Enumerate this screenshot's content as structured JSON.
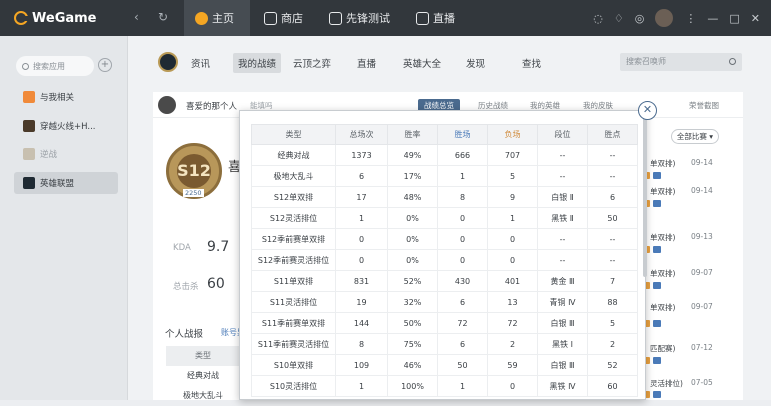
{
  "app": {
    "brand": "WeGame",
    "nav": [
      {
        "label": "主页",
        "active": true
      },
      {
        "label": "商店",
        "active": false
      },
      {
        "label": "先锋测试",
        "active": false
      },
      {
        "label": "直播",
        "active": false
      }
    ],
    "icons": [
      "back-arrow-icon",
      "refresh-icon",
      "chat-icon",
      "gift-icon",
      "game-controller-icon",
      "menu-icon",
      "minimize-icon",
      "maximize-icon",
      "close-icon"
    ]
  },
  "sidebar": {
    "search_placeholder": "搜索应用",
    "items": [
      {
        "label": "与我相关",
        "color": "#f08a3a"
      },
      {
        "label": "穿越火线+H...",
        "color": "#4a3a2a"
      },
      {
        "label": "逆战",
        "color": "#c8c0b0"
      },
      {
        "label": "英雄联盟",
        "color": "#1f2a33",
        "active": true
      }
    ]
  },
  "subnav": {
    "items": [
      "资讯",
      "我的战绩",
      "云顶之弈",
      "直播",
      "英雄大全",
      "发现",
      "查找"
    ],
    "active_index": 1,
    "search_placeholder": "搜索召唤师"
  },
  "profile": {
    "name": "喜爱的那个人",
    "rename": "能填吗",
    "tabs": [
      "战绩总览",
      "历史战绩",
      "我的英雄",
      "我的皮肤"
    ],
    "active_tab": 0,
    "right_tab": "荣誉截图",
    "big_name": "喜",
    "rank_text": "S12",
    "level": "2250",
    "kda_label": "KDA",
    "kda_value": "9.7",
    "kills_label": "总击杀",
    "kills_value": "60",
    "section_title": "个人战报",
    "section_link": "账号异",
    "under_table": {
      "header": "类型",
      "rows": [
        "经典对战",
        "极地大乱斗"
      ]
    }
  },
  "right_list": {
    "filter": "全部比赛",
    "entries": [
      {
        "mode": "单双排)",
        "date": "09-14"
      },
      {
        "mode": "单双排)",
        "date": "09-14"
      },
      {
        "mode": "单双排)",
        "date": "09-13"
      },
      {
        "mode": "单双排)",
        "date": "09-07"
      },
      {
        "mode": "单双排)",
        "date": "09-07"
      },
      {
        "mode": "匹配赛)",
        "date": "07-12"
      },
      {
        "mode": "灵活排位)",
        "date": "07-05"
      }
    ]
  },
  "modal": {
    "columns": [
      "类型",
      "总场次",
      "胜率",
      "胜场",
      "负场",
      "段位",
      "胜点"
    ],
    "rows": [
      [
        "经典对战",
        "1373",
        "49%",
        "666",
        "707",
        "--",
        "--"
      ],
      [
        "极地大乱斗",
        "6",
        "17%",
        "1",
        "5",
        "--",
        "--"
      ],
      [
        "S12单双排",
        "17",
        "48%",
        "8",
        "9",
        "白银 Ⅱ",
        "6"
      ],
      [
        "S12灵活排位",
        "1",
        "0%",
        "0",
        "1",
        "黑铁 Ⅱ",
        "50"
      ],
      [
        "S12季前赛单双排",
        "0",
        "0%",
        "0",
        "0",
        "--",
        "--"
      ],
      [
        "S12季前赛灵活排位",
        "0",
        "0%",
        "0",
        "0",
        "--",
        "--"
      ],
      [
        "S11单双排",
        "831",
        "52%",
        "430",
        "401",
        "黄金 Ⅲ",
        "7"
      ],
      [
        "S11灵活排位",
        "19",
        "32%",
        "6",
        "13",
        "青铜 Ⅳ",
        "88"
      ],
      [
        "S11季前赛单双排",
        "144",
        "50%",
        "72",
        "72",
        "白银 Ⅲ",
        "5"
      ],
      [
        "S11季前赛灵活排位",
        "8",
        "75%",
        "6",
        "2",
        "黑铁 Ⅰ",
        "2"
      ],
      [
        "S10单双排",
        "109",
        "46%",
        "50",
        "59",
        "白银 Ⅲ",
        "52"
      ],
      [
        "S10灵活排位",
        "1",
        "100%",
        "1",
        "0",
        "黑铁 Ⅳ",
        "60"
      ]
    ]
  }
}
